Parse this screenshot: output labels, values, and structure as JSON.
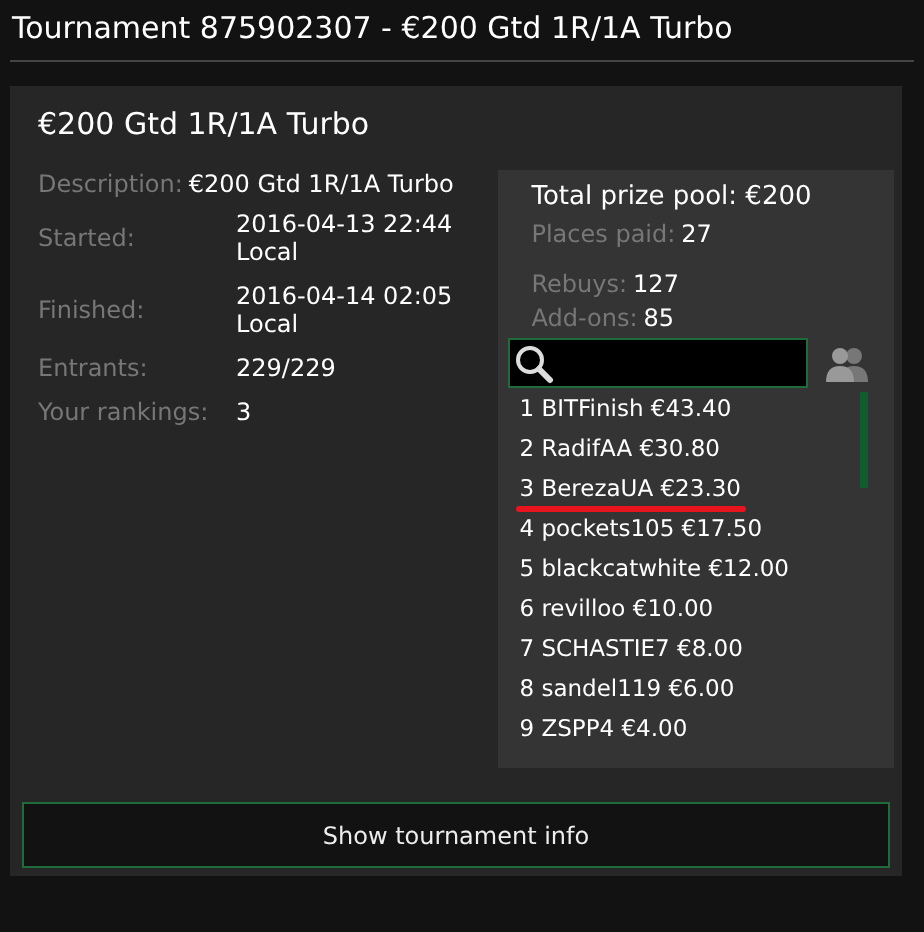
{
  "window": {
    "title": "Tournament 875902307 - €200 Gtd 1R/1A Turbo"
  },
  "card": {
    "title": "€200 Gtd 1R/1A Turbo",
    "details": [
      {
        "label": "Description:",
        "value": "€200 Gtd 1R/1A Turbo",
        "kind": "inline"
      },
      {
        "label": "Started:",
        "value": "2016-04-13 22:44 Local",
        "kind": "block"
      },
      {
        "label": "Finished:",
        "value": "2016-04-14 02:05 Local",
        "kind": "block"
      },
      {
        "label": "Entrants:",
        "value": "229/229",
        "kind": "block"
      },
      {
        "label": "Your rankings:",
        "value": "3",
        "kind": "block"
      }
    ],
    "prize": {
      "title": "Total prize pool: €200",
      "stats": [
        {
          "label": "Places paid:",
          "value": "27"
        },
        {
          "label": "Rebuys:",
          "value": "127"
        },
        {
          "label": "Add-ons:",
          "value": "85"
        }
      ],
      "rankings": [
        {
          "text": "1 BITFinish €43.40",
          "highlighted": false
        },
        {
          "text": "2 RadifAA €30.80",
          "highlighted": false
        },
        {
          "text": "3 BerezaUA €23.30",
          "highlighted": true
        },
        {
          "text": "4 pockets105 €17.50",
          "highlighted": false
        },
        {
          "text": "5 blackcatwhite €12.00",
          "highlighted": false
        },
        {
          "text": "6 revilloo €10.00",
          "highlighted": false
        },
        {
          "text": "7 SCHASTIE7 €8.00",
          "highlighted": false
        },
        {
          "text": "8 sandel119 €6.00",
          "highlighted": false
        },
        {
          "text": "9 ZSPP4 €4.00",
          "highlighted": false
        }
      ]
    }
  },
  "button": {
    "label": "Show tournament info"
  }
}
